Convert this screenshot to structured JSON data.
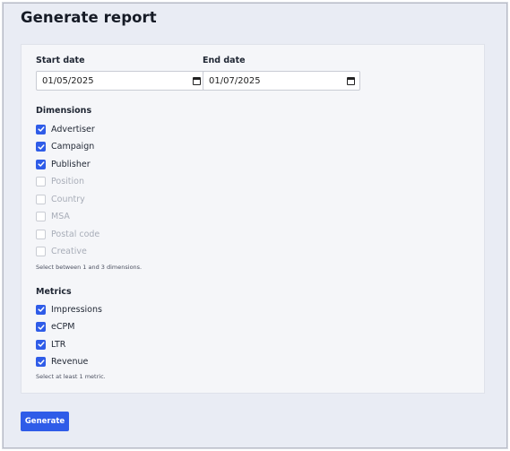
{
  "page": {
    "title": "Generate report"
  },
  "dates": {
    "start": {
      "label": "Start date",
      "value": "01/05/2025"
    },
    "end": {
      "label": "End date",
      "value": "01/07/2025"
    }
  },
  "dimensions": {
    "label": "Dimensions",
    "items": [
      {
        "label": "Advertiser",
        "checked": true,
        "disabled": false
      },
      {
        "label": "Campaign",
        "checked": true,
        "disabled": false
      },
      {
        "label": "Publisher",
        "checked": true,
        "disabled": false
      },
      {
        "label": "Position",
        "checked": false,
        "disabled": true
      },
      {
        "label": "Country",
        "checked": false,
        "disabled": true
      },
      {
        "label": "MSA",
        "checked": false,
        "disabled": true
      },
      {
        "label": "Postal code",
        "checked": false,
        "disabled": true
      },
      {
        "label": "Creative",
        "checked": false,
        "disabled": true
      }
    ],
    "hint": "Select between 1 and 3 dimensions."
  },
  "metrics": {
    "label": "Metrics",
    "items": [
      {
        "label": "Impressions",
        "checked": true,
        "disabled": false
      },
      {
        "label": "eCPM",
        "checked": true,
        "disabled": false
      },
      {
        "label": "LTR",
        "checked": true,
        "disabled": false
      },
      {
        "label": "Revenue",
        "checked": true,
        "disabled": false
      }
    ],
    "hint": "Select at least 1 metric."
  },
  "actions": {
    "generate_label": "Generate"
  },
  "colors": {
    "accent": "#2f5ce8",
    "background": "#e9ecf4",
    "card": "#f5f6f9",
    "disabled_text": "#a8adb8"
  },
  "icons": {
    "date_picker": "calendar-icon",
    "checkbox_mark": "checkmark-icon"
  }
}
